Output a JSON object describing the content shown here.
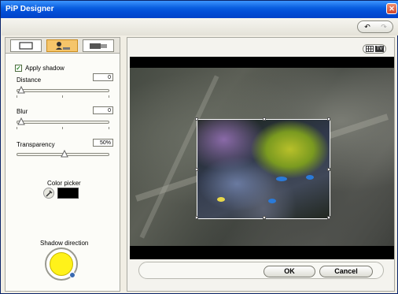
{
  "window": {
    "title": "PiP Designer"
  },
  "shadow": {
    "apply_shadow_label": "Apply shadow",
    "apply_shadow_checked": true,
    "distance": {
      "label": "Distance",
      "value": "0"
    },
    "blur": {
      "label": "Blur",
      "value": "0"
    },
    "transparency": {
      "label": "Transparency",
      "value": "50%"
    },
    "color_picker_label": "Color picker",
    "shadow_color": "#000000",
    "shadow_direction_label": "Shadow direction"
  },
  "tabs": [
    "frame-tab",
    "shadow-tab",
    "properties-tab"
  ],
  "icons": {
    "undo": "undo-icon",
    "redo": "redo-icon",
    "grid": "grid-icon",
    "tv": "tv-icon",
    "eyedropper": "eyedropper-icon",
    "close": "close-icon"
  },
  "buttons": {
    "ok": "OK",
    "cancel": "Cancel",
    "tv_label": "TV"
  }
}
